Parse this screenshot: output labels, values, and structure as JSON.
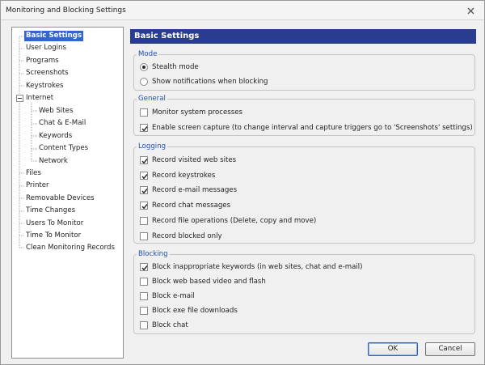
{
  "window": {
    "title": "Monitoring and Blocking Settings",
    "close_icon": "close-icon"
  },
  "tree": {
    "items": [
      {
        "label": "Basic Settings",
        "selected": true
      },
      {
        "label": "User Logins"
      },
      {
        "label": "Programs"
      },
      {
        "label": "Screenshots"
      },
      {
        "label": "Keystrokes"
      },
      {
        "label": "Internet",
        "expanded": true
      },
      {
        "label": "Web Sites"
      },
      {
        "label": "Chat & E-Mail"
      },
      {
        "label": "Keywords"
      },
      {
        "label": "Content Types"
      },
      {
        "label": "Network"
      },
      {
        "label": "Files"
      },
      {
        "label": "Printer"
      },
      {
        "label": "Removable Devices"
      },
      {
        "label": "Time Changes"
      },
      {
        "label": "Users To Monitor"
      },
      {
        "label": "Time To Monitor"
      },
      {
        "label": "Clean Monitoring Records"
      }
    ]
  },
  "content": {
    "header": "Basic Settings",
    "mode": {
      "title": "Mode",
      "options": [
        {
          "label": "Stealth mode",
          "selected": true
        },
        {
          "label": "Show notifications when blocking",
          "selected": false
        }
      ]
    },
    "general": {
      "title": "General",
      "items": [
        {
          "label": "Monitor system processes",
          "checked": false
        },
        {
          "label": "Enable screen capture (to change  interval and capture triggers go to 'Screenshots' settings)",
          "checked": true
        }
      ]
    },
    "logging": {
      "title": "Logging",
      "items": [
        {
          "label": "Record visited web sites",
          "checked": true
        },
        {
          "label": "Record keystrokes",
          "checked": true
        },
        {
          "label": "Record e-mail messages",
          "checked": true
        },
        {
          "label": "Record chat messages",
          "checked": true
        },
        {
          "label": "Record file operations (Delete, copy and move)",
          "checked": false
        },
        {
          "label": "Record blocked only",
          "checked": false
        }
      ]
    },
    "blocking": {
      "title": "Blocking",
      "items": [
        {
          "label": "Block inappropriate keywords (in web sites, chat and e-mail)",
          "checked": true
        },
        {
          "label": "Block web based video and flash",
          "checked": false
        },
        {
          "label": "Block e-mail",
          "checked": false
        },
        {
          "label": "Block exe file downloads",
          "checked": false
        },
        {
          "label": "Block chat",
          "checked": false
        }
      ]
    }
  },
  "buttons": {
    "ok": "OK",
    "cancel": "Cancel"
  },
  "colors": {
    "header_bg": "#2a3c8f",
    "selection_bg": "#3168c8",
    "group_title": "#1e50b4"
  }
}
